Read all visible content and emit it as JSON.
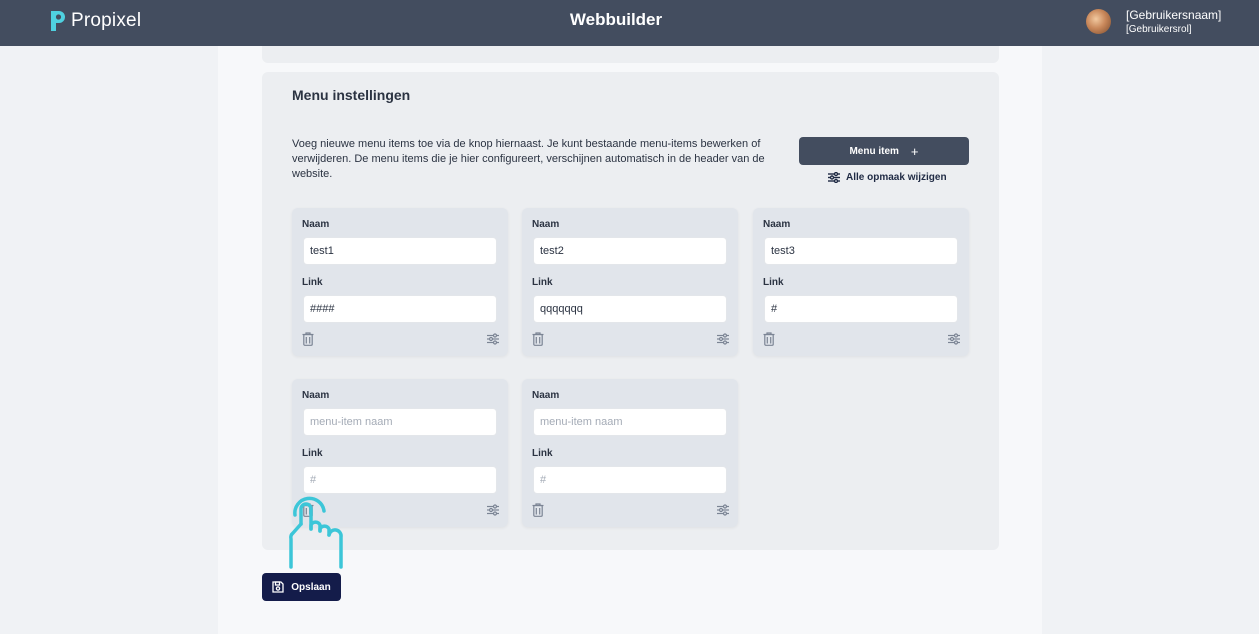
{
  "header": {
    "logo_text": "Propixel",
    "title": "Webbuilder",
    "user_name": "[Gebruikersnaam]",
    "user_role": "[Gebruikersrol]"
  },
  "menu_settings": {
    "title": "Menu instellingen",
    "description": "Voeg nieuwe menu items toe via de knop hiernaast. Je kunt bestaande menu-items bewerken of verwijderen. De menu items die je hier configureert, verschijnen automatisch in de header van de website.",
    "add_button_label": "Menu item",
    "add_button_icon": "+",
    "style_link_label": "Alle opmaak wijzigen",
    "name_label": "Naam",
    "link_label": "Link",
    "items": [
      {
        "name": "test1",
        "name_placeholder": "menu-item naam",
        "link": "####",
        "link_placeholder": "#"
      },
      {
        "name": "test2",
        "name_placeholder": "menu-item naam",
        "link": "qqqqqqq",
        "link_placeholder": "#"
      },
      {
        "name": "test3",
        "name_placeholder": "menu-item naam",
        "link": "#",
        "link_placeholder": "#"
      },
      {
        "name": "",
        "name_placeholder": "menu-item naam",
        "link": "",
        "link_placeholder": "#"
      },
      {
        "name": "",
        "name_placeholder": "menu-item naam",
        "link": "",
        "link_placeholder": "#"
      }
    ]
  },
  "footer": {
    "save_label": "Opslaan"
  },
  "colors": {
    "header_bg": "#434d5f",
    "logo_accent": "#4fd1e0",
    "save_bg": "#141c4a",
    "hand_cursor": "#3cc6d8"
  },
  "icons": {
    "trash": "trash-icon",
    "settings": "sliders-icon",
    "save": "floppy-disk-icon",
    "cursor": "hand-pointer-icon"
  }
}
